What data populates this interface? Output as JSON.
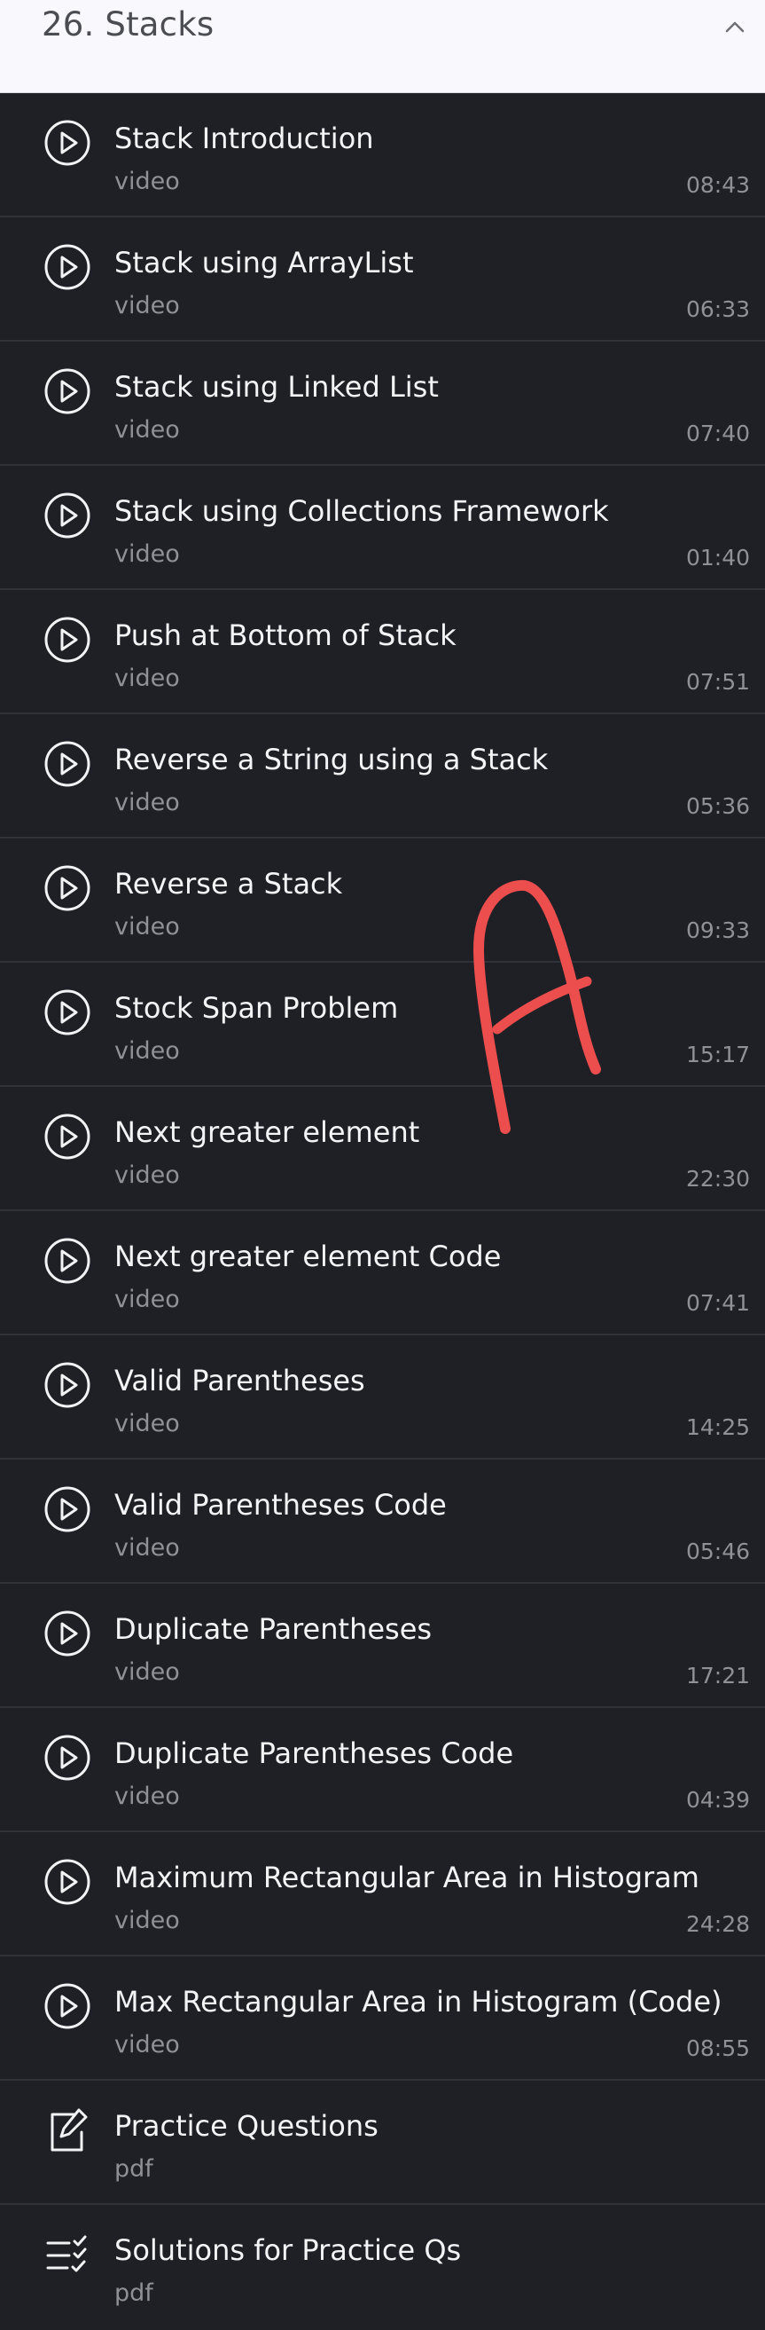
{
  "section": {
    "title": "26. Stacks",
    "toggle_icon": "chevron-up-icon"
  },
  "lessons": [
    {
      "title": "Stack Introduction",
      "type": "video",
      "duration": "08:43",
      "icon": "play-circle-icon"
    },
    {
      "title": "Stack using ArrayList",
      "type": "video",
      "duration": "06:33",
      "icon": "play-circle-icon"
    },
    {
      "title": "Stack using Linked List",
      "type": "video",
      "duration": "07:40",
      "icon": "play-circle-icon"
    },
    {
      "title": "Stack using Collections Framework",
      "type": "video",
      "duration": "01:40",
      "icon": "play-circle-icon"
    },
    {
      "title": "Push at Bottom of Stack",
      "type": "video",
      "duration": "07:51",
      "icon": "play-circle-icon"
    },
    {
      "title": "Reverse a String using a Stack",
      "type": "video",
      "duration": "05:36",
      "icon": "play-circle-icon"
    },
    {
      "title": "Reverse a Stack",
      "type": "video",
      "duration": "09:33",
      "icon": "play-circle-icon"
    },
    {
      "title": "Stock Span Problem",
      "type": "video",
      "duration": "15:17",
      "icon": "play-circle-icon"
    },
    {
      "title": "Next greater element",
      "type": "video",
      "duration": "22:30",
      "icon": "play-circle-icon"
    },
    {
      "title": "Next greater element Code",
      "type": "video",
      "duration": "07:41",
      "icon": "play-circle-icon"
    },
    {
      "title": "Valid Parentheses",
      "type": "video",
      "duration": "14:25",
      "icon": "play-circle-icon"
    },
    {
      "title": "Valid Parentheses Code",
      "type": "video",
      "duration": "05:46",
      "icon": "play-circle-icon"
    },
    {
      "title": "Duplicate Parentheses",
      "type": "video",
      "duration": "17:21",
      "icon": "play-circle-icon"
    },
    {
      "title": "Duplicate Parentheses Code",
      "type": "video",
      "duration": "04:39",
      "icon": "play-circle-icon"
    },
    {
      "title": "Maximum Rectangular Area in Histogram",
      "type": "video",
      "duration": "24:28",
      "icon": "play-circle-icon"
    },
    {
      "title": "Max Rectangular Area in Histogram (Code)",
      "type": "video",
      "duration": "08:55",
      "icon": "play-circle-icon"
    },
    {
      "title": "Practice Questions",
      "type": "pdf",
      "duration": "",
      "icon": "edit-document-icon"
    },
    {
      "title": "Solutions for Practice Qs",
      "type": "pdf",
      "duration": "",
      "icon": "checklist-icon"
    }
  ],
  "annotation": {
    "text": "A",
    "color": "#ec4d4d"
  }
}
